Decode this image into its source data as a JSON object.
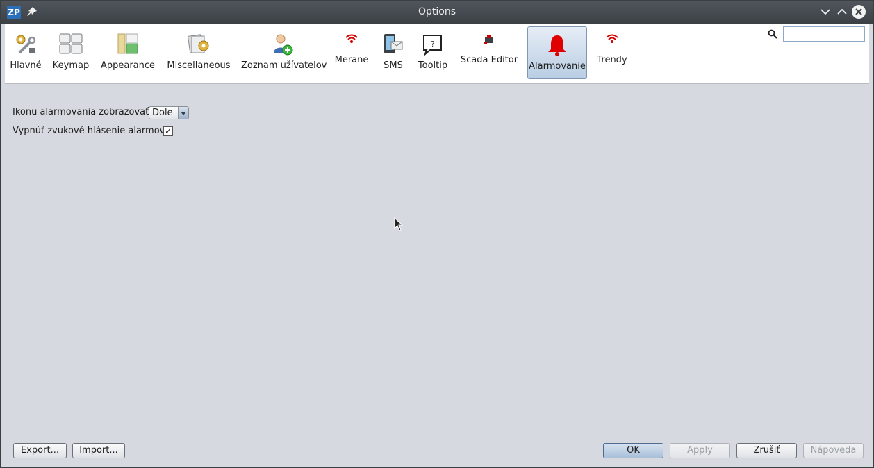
{
  "window": {
    "title": "Options",
    "logo": "ZP"
  },
  "categories": [
    {
      "label": "Hlavné",
      "icon": "wrench-gear-icon"
    },
    {
      "label": "Keymap",
      "icon": "keyboard-icon"
    },
    {
      "label": "Appearance",
      "icon": "layout-icon"
    },
    {
      "label": "Miscellaneous",
      "icon": "misc-gear-icon"
    },
    {
      "label": "Zoznam užívatelov",
      "icon": "user-add-icon"
    },
    {
      "label": "Merane",
      "icon": "wifi-signal-icon"
    },
    {
      "label": "SMS",
      "icon": "phone-mail-icon"
    },
    {
      "label": "Tooltip",
      "icon": "tooltip-icon"
    },
    {
      "label": "Scada Editor",
      "icon": "scada-icon"
    },
    {
      "label": "Alarmovanie",
      "icon": "bell-icon",
      "selected": true
    },
    {
      "label": "Trendy",
      "icon": "wifi-signal-icon"
    }
  ],
  "search": {
    "value": "",
    "placeholder": ""
  },
  "settings": {
    "alarm_icon_label": "Ikonu alarmovania zobrazovať:",
    "alarm_icon_value": "Dole",
    "sound_off_label": "Vypnúť zvukové hlásenie alarmov:",
    "sound_off_checked": true,
    "check_mark": "✓"
  },
  "buttons": {
    "export": "Export...",
    "import": "Import...",
    "ok": "OK",
    "apply": "Apply",
    "cancel": "Zrušiť",
    "help": "Nápoveda"
  },
  "colors": {
    "accent": "#e00000",
    "selected_bg": "#b9cde3",
    "titlebar": "#3b4045"
  }
}
